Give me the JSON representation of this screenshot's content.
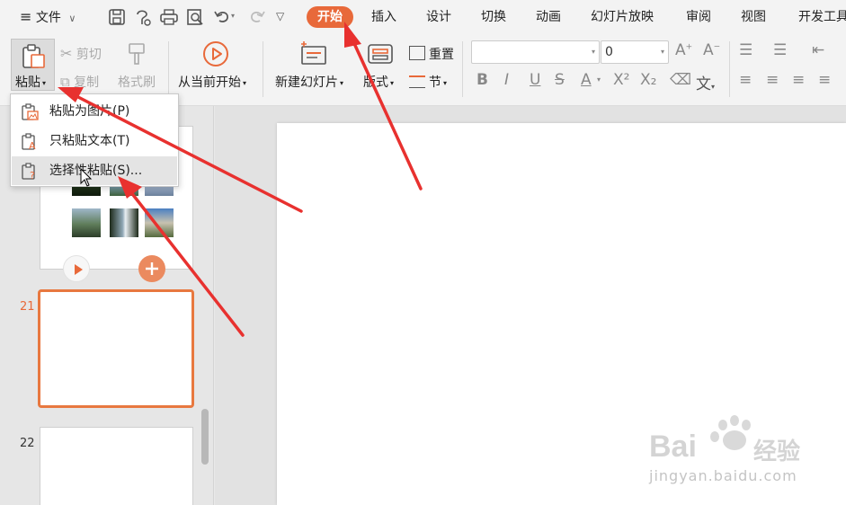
{
  "menubar": {
    "file": "文件",
    "tabs": [
      "开始",
      "插入",
      "设计",
      "切换",
      "动画",
      "幻灯片放映",
      "审阅",
      "视图",
      "开发工具"
    ],
    "active_tab": "开始",
    "quick_icons": [
      "save-icon",
      "undo-history-icon",
      "print-icon",
      "print-preview-icon",
      "undo-icon",
      "redo-icon",
      "more-icon"
    ]
  },
  "ribbon": {
    "paste": "粘贴",
    "cut": "剪切",
    "copy": "复制",
    "format_painter": "格式刷",
    "play_from_current": "从当前开始",
    "new_slide": "新建幻灯片",
    "layout": "版式",
    "reset": "重置",
    "section": "节",
    "font_size": "0",
    "format_buttons": [
      "B",
      "I",
      "U",
      "S",
      "A",
      "X²",
      "X₂"
    ]
  },
  "paste_menu": {
    "items": [
      "粘贴为图片(P)",
      "只粘贴文本(T)",
      "选择性粘贴(S)..."
    ],
    "hovered_index": 2
  },
  "thumbnails": {
    "numbers": [
      "21",
      "22"
    ],
    "selected": "21"
  },
  "watermark": {
    "brand": "Bai",
    "brand_cn": "经验",
    "url": "jingyan.baidu.com"
  },
  "colors": {
    "accent": "#e8693a",
    "arrow": "#e8312f",
    "selection": "#e8783f"
  }
}
